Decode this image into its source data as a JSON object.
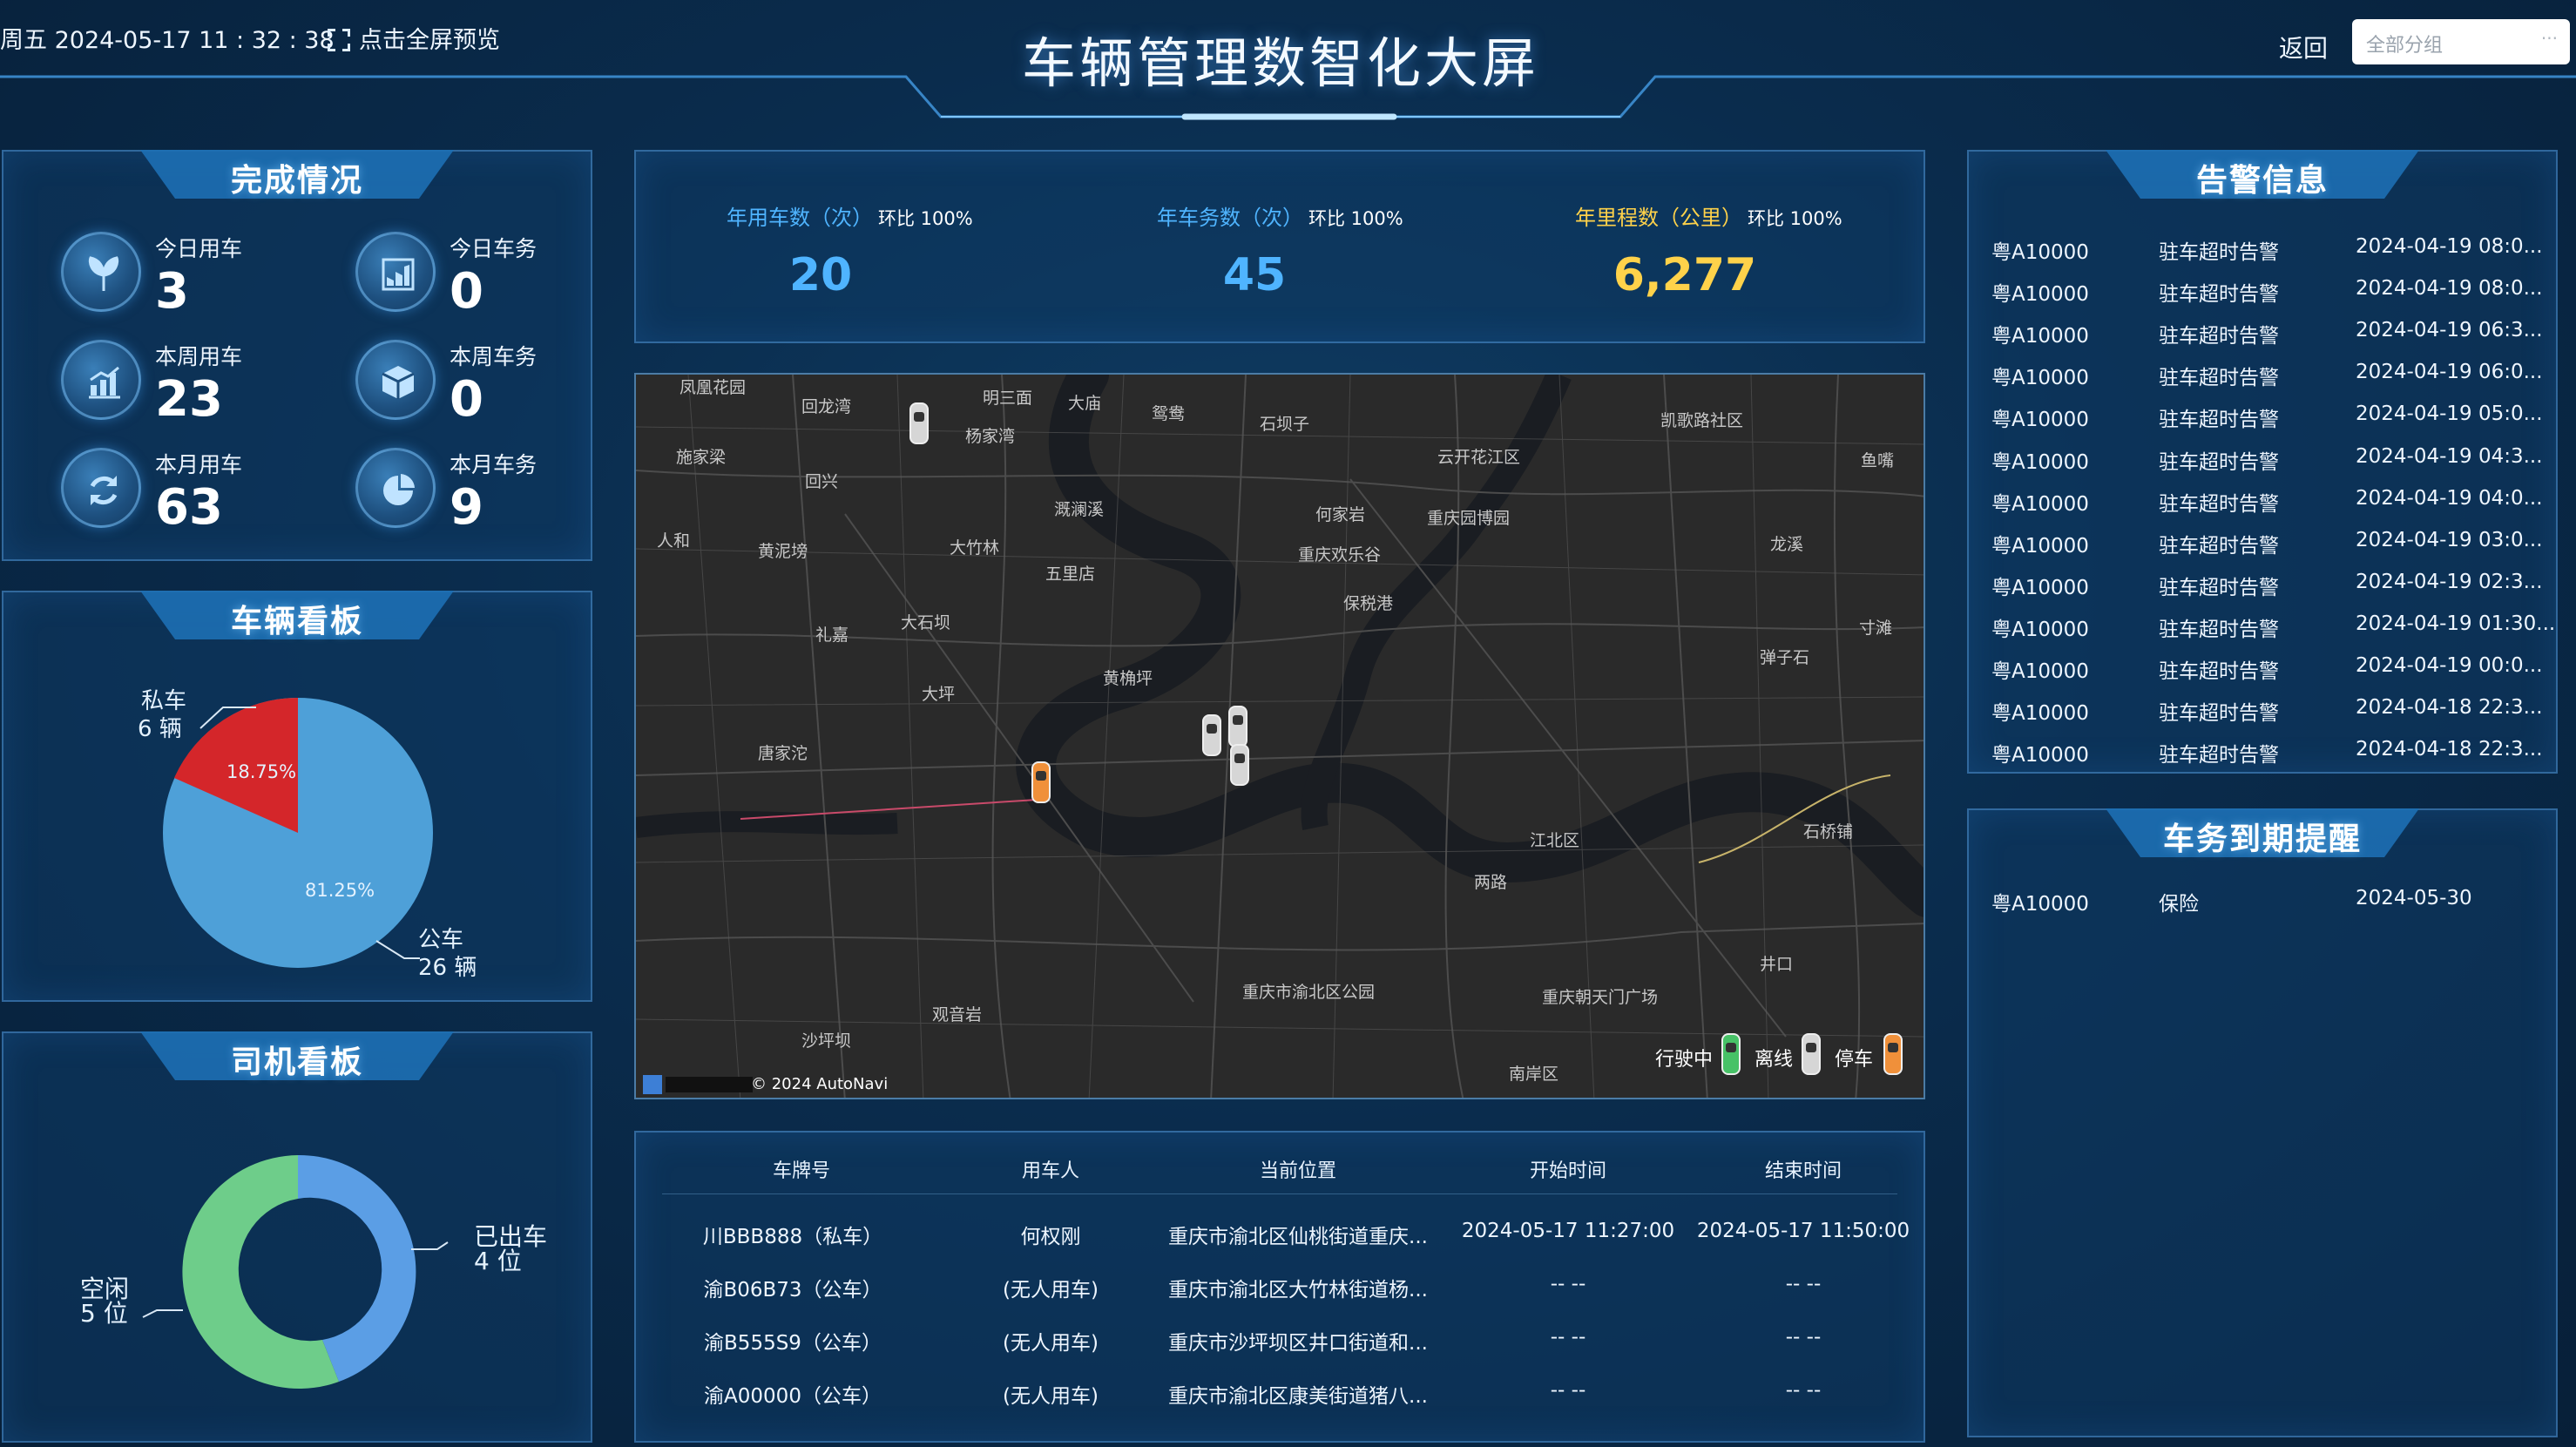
{
  "header": {
    "datetime": "周五 2024-05-17 11 : 32 : 38",
    "fullscreen_label": "点击全屏预览",
    "title": "车辆管理数智化大屏",
    "back_label": "返回",
    "select_placeholder": "全部分组",
    "select_dots": "···"
  },
  "completion": {
    "title": "完成情况",
    "items": [
      {
        "label": "今日用车",
        "value": "3",
        "icon": "sprout-icon"
      },
      {
        "label": "今日车务",
        "value": "0",
        "icon": "chart-up-icon"
      },
      {
        "label": "本周用车",
        "value": "23",
        "icon": "bar-chart-icon"
      },
      {
        "label": "本周车务",
        "value": "0",
        "icon": "cube-icon"
      },
      {
        "label": "本月用车",
        "value": "63",
        "icon": "refresh-icon"
      },
      {
        "label": "本月车务",
        "value": "9",
        "icon": "pie-icon"
      }
    ]
  },
  "vehicle_board": {
    "title": "车辆看板",
    "private_label": "私车",
    "private_count": "6 辆",
    "private_pct": "18.75%",
    "public_label": "公车",
    "public_count": "26 辆",
    "public_pct": "81.25%"
  },
  "driver_board": {
    "title": "司机看板",
    "out_label": "已出车",
    "out_count": "4 位",
    "idle_label": "空闲",
    "idle_count": "5 位"
  },
  "kpis": [
    {
      "label": "年用车数（次）",
      "ratio": "环比 100%",
      "value": "20",
      "color": "#4fb4ff"
    },
    {
      "label": "年车务数（次）",
      "ratio": "环比 100%",
      "value": "45",
      "color": "#4fb4ff"
    },
    {
      "label": "年里程数（公里）",
      "ratio": "环比 100%",
      "value": "6,277",
      "color": "#ffd24a"
    }
  ],
  "map": {
    "copyright": "© 2024 AutoNavi",
    "legend": {
      "driving": "行驶中",
      "offline": "离线",
      "parked": "停车"
    },
    "labels": [
      "凤凰花园",
      "回龙湾",
      "明三面",
      "大庙",
      "鸳鸯",
      "石坝子",
      "云开花江区",
      "凯歌路社区",
      "施家梁",
      "杨家湾",
      "回兴",
      "溉澜溪",
      "何家岩",
      "重庆园博园",
      "大竹林",
      "人和",
      "黄泥塝",
      "五里店",
      "重庆欢乐谷",
      "龙溪",
      "礼嘉",
      "鱼嘴",
      "保税港",
      "大石坝",
      "寸滩",
      "黄桷坪",
      "弹子石",
      "大坪",
      "唐家沱",
      "两路",
      "石桥铺",
      "井口",
      "观音岩",
      "沙坪坝",
      "重庆市渝北区公园",
      "重庆朝天门广场",
      "江北区",
      "南岸区"
    ]
  },
  "alerts": {
    "title": "告警信息",
    "rows": [
      [
        "粤A10000",
        "驻车超时告警",
        "2024-04-19 08:0..."
      ],
      [
        "粤A10000",
        "驻车超时告警",
        "2024-04-19 08:0..."
      ],
      [
        "粤A10000",
        "驻车超时告警",
        "2024-04-19 06:3..."
      ],
      [
        "粤A10000",
        "驻车超时告警",
        "2024-04-19 06:0..."
      ],
      [
        "粤A10000",
        "驻车超时告警",
        "2024-04-19 05:0..."
      ],
      [
        "粤A10000",
        "驻车超时告警",
        "2024-04-19 04:3..."
      ],
      [
        "粤A10000",
        "驻车超时告警",
        "2024-04-19 04:0..."
      ],
      [
        "粤A10000",
        "驻车超时告警",
        "2024-04-19 03:0..."
      ],
      [
        "粤A10000",
        "驻车超时告警",
        "2024-04-19 02:3..."
      ],
      [
        "粤A10000",
        "驻车超时告警",
        "2024-04-19 01:30..."
      ],
      [
        "粤A10000",
        "驻车超时告警",
        "2024-04-19 00:0..."
      ],
      [
        "粤A10000",
        "驻车超时告警",
        "2024-04-18 22:3..."
      ],
      [
        "粤A10000",
        "驻车超时告警",
        "2024-04-18 22:3..."
      ]
    ]
  },
  "expiry": {
    "title": "车务到期提醒",
    "rows": [
      [
        "粤A10000",
        "保险",
        "2024-05-30"
      ]
    ]
  },
  "trips": {
    "headers": [
      "车牌号",
      "用车人",
      "当前位置",
      "开始时间",
      "结束时间"
    ],
    "rows": [
      [
        "川BBB888（私车）",
        "何权刚",
        "重庆市渝北区仙桃街道重庆...",
        "2024-05-17 11:27:00",
        "2024-05-17 11:50:00"
      ],
      [
        "渝B06B73（公车）",
        "(无人用车)",
        "重庆市渝北区大竹林街道杨...",
        "-- --",
        "-- --"
      ],
      [
        "渝B555S9（公车）",
        "(无人用车)",
        "重庆市沙坪坝区井口街道和...",
        "-- --",
        "-- --"
      ],
      [
        "渝A00000（公车）",
        "(无人用车)",
        "重庆市渝北区康美街道猪八...",
        "-- --",
        "-- --"
      ]
    ]
  }
}
